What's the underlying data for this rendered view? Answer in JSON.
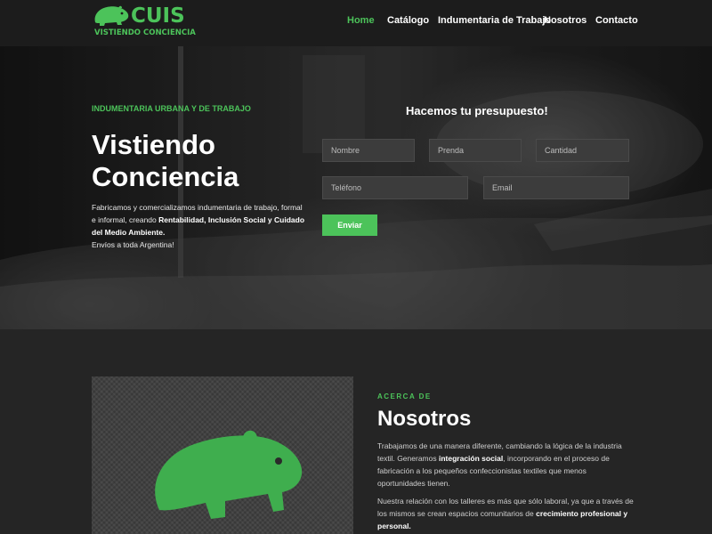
{
  "brand": {
    "name": "CUIS",
    "tagline": "VISTIENDO CONCIENCIA",
    "accent": "#4cc35a",
    "logo_icon": "guinea-pig-icon"
  },
  "nav": {
    "items": [
      {
        "label": "Home",
        "active": true
      },
      {
        "label": "Catálogo",
        "active": false
      },
      {
        "label": "Indumentaria de Trabajo",
        "active": false
      },
      {
        "label": "Nosotros",
        "active": false
      },
      {
        "label": "Contacto",
        "active": false
      }
    ]
  },
  "hero": {
    "eyebrow": "INDUMENTARIA URBANA Y DE TRABAJO",
    "title": "Vistiendo Conciencia",
    "desc_lead": "Fabricamos y comercializamos indumentaria de trabajo, formal e informal, creando ",
    "desc_bold": "Rentabilidad, Inclusión Social y Cuidado del Medio Ambiente.",
    "desc_tail": "Envíos a toda Argentina!"
  },
  "form": {
    "title": "Hacemos tu presupuesto!",
    "fields": {
      "name_placeholder": "Nombre",
      "garment_placeholder": "Prenda",
      "quantity_placeholder": "Cantidad",
      "phone_placeholder": "Teléfono",
      "email_placeholder": "Email"
    },
    "submit_label": "Enviar"
  },
  "about": {
    "eyebrow": "ACERCA DE",
    "title": "Nosotros",
    "p1_a": "Trabajamos de una manera diferente, cambiando la lógica de la industria textil. Generamos ",
    "p1_b": "integración social",
    "p1_c": ", incorporando en el proceso de fabricación a los pequeños confeccionistas textiles que menos oportunidades tienen.",
    "p2_a": "Nuestra relación con los talleres es más que sólo laboral, ya que a través de los mismos se crean espacios comunitarios de ",
    "p2_b": "crecimiento profesional y personal."
  }
}
